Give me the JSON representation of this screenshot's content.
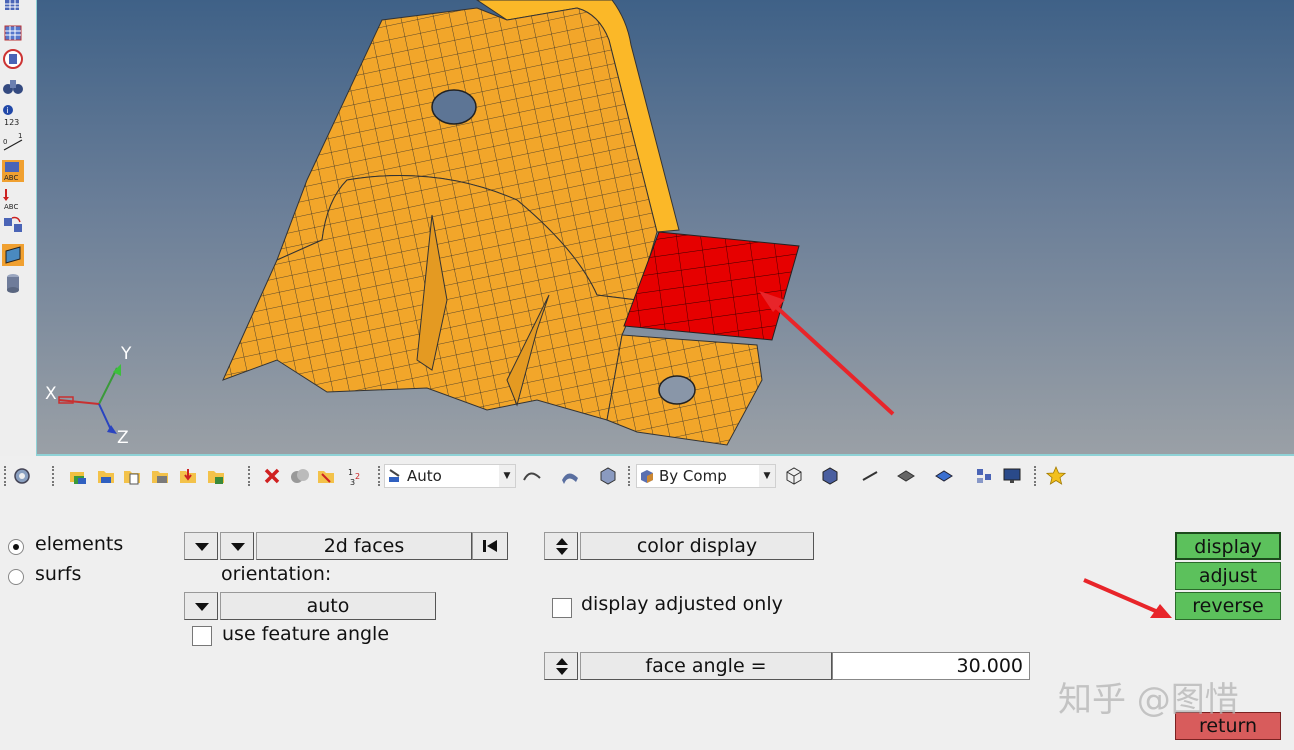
{
  "viewport": {
    "axis_labels": {
      "x": "X",
      "y": "Y",
      "z": "Z"
    },
    "colors": {
      "background_top": "#3f6187",
      "background_bottom": "#9aa0a6",
      "mesh": "#f2a62a",
      "selected_mesh": "#e60000",
      "annotation_arrow": "#e8252a"
    }
  },
  "left_toolbar": {
    "icons": [
      "mesh-icon",
      "mesh-grid-icon",
      "sphere-icon",
      "binoculars-icon",
      "info-123-icon",
      "dimension-icon",
      "abc-label-icon",
      "abc-arrow-icon",
      "swap-icon",
      "mesh-frame-icon",
      "cylinder-icon"
    ]
  },
  "toolbar": {
    "visualization_dropdown": "Auto",
    "color_by_dropdown": "By Comp"
  },
  "panel": {
    "radio_elements": "elements",
    "radio_surfs": "surfs",
    "faces_button": "2d faces",
    "orientation_label": "orientation:",
    "auto_button": "auto",
    "use_feature_angle_label": "use feature angle",
    "color_display_button": "color display",
    "display_adjusted_only_label": "display adjusted only",
    "face_angle_button": "face angle =",
    "face_angle_value": "30.000",
    "display_button": "display",
    "adjust_button": "adjust",
    "reverse_button": "reverse",
    "return_button": "return"
  },
  "watermark": "知乎 @图惜"
}
